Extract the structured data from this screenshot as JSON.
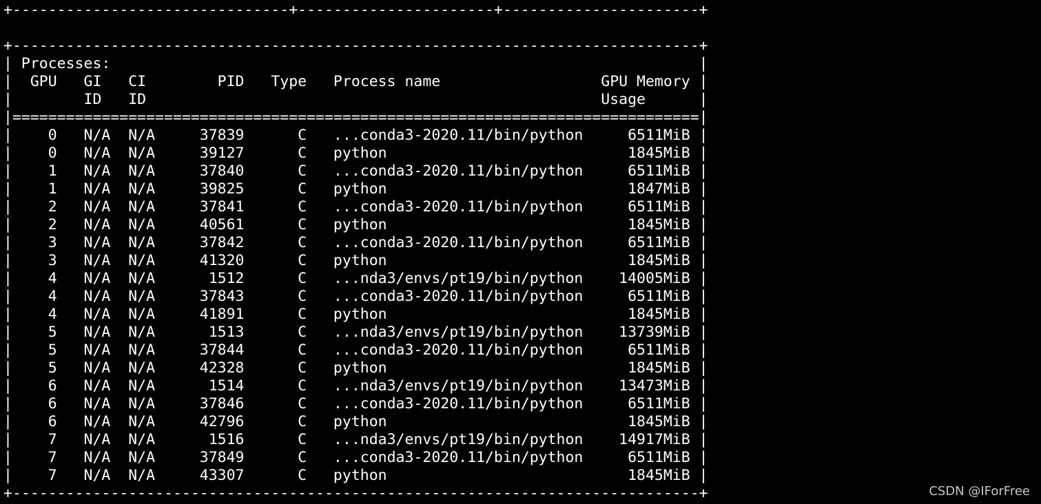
{
  "terminal": {
    "lines": [
      "+-------------------------------+----------------------+----------------------+",
      "",
      "+-----------------------------------------------------------------------------+",
      "| Processes:                                                                  |",
      "|  GPU   GI   CI        PID   Type   Process name                  GPU Memory |",
      "|        ID   ID                                                   Usage      |",
      "|=============================================================================|",
      "|    0   N/A  N/A     37839      C   ...conda3-2020.11/bin/python     6511MiB |",
      "|    0   N/A  N/A     39127      C   python                           1845MiB |",
      "|    1   N/A  N/A     37840      C   ...conda3-2020.11/bin/python     6511MiB |",
      "|    1   N/A  N/A     39825      C   python                           1847MiB |",
      "|    2   N/A  N/A     37841      C   ...conda3-2020.11/bin/python     6511MiB |",
      "|    2   N/A  N/A     40561      C   python                           1845MiB |",
      "|    3   N/A  N/A     37842      C   ...conda3-2020.11/bin/python     6511MiB |",
      "|    3   N/A  N/A     41320      C   python                           1845MiB |",
      "|    4   N/A  N/A      1512      C   ...nda3/envs/pt19/bin/python    14005MiB |",
      "|    4   N/A  N/A     37843      C   ...conda3-2020.11/bin/python     6511MiB |",
      "|    4   N/A  N/A     41891      C   python                           1845MiB |",
      "|    5   N/A  N/A      1513      C   ...nda3/envs/pt19/bin/python    13739MiB |",
      "|    5   N/A  N/A     37844      C   ...conda3-2020.11/bin/python     6511MiB |",
      "|    5   N/A  N/A     42328      C   python                           1845MiB |",
      "|    6   N/A  N/A      1514      C   ...nda3/envs/pt19/bin/python    13473MiB |",
      "|    6   N/A  N/A     37846      C   ...conda3-2020.11/bin/python     6511MiB |",
      "|    6   N/A  N/A     42796      C   python                           1845MiB |",
      "|    7   N/A  N/A      1516      C   ...nda3/envs/pt19/bin/python    14917MiB |",
      "|    7   N/A  N/A     37849      C   ...conda3-2020.11/bin/python     6511MiB |",
      "|    7   N/A  N/A     43307      C   python                           1845MiB |",
      "+-----------------------------------------------------------------------------+"
    ]
  },
  "watermark": {
    "text": "CSDN @IForFree"
  },
  "colors": {
    "background": "#000000",
    "foreground": "#ffffff"
  }
}
